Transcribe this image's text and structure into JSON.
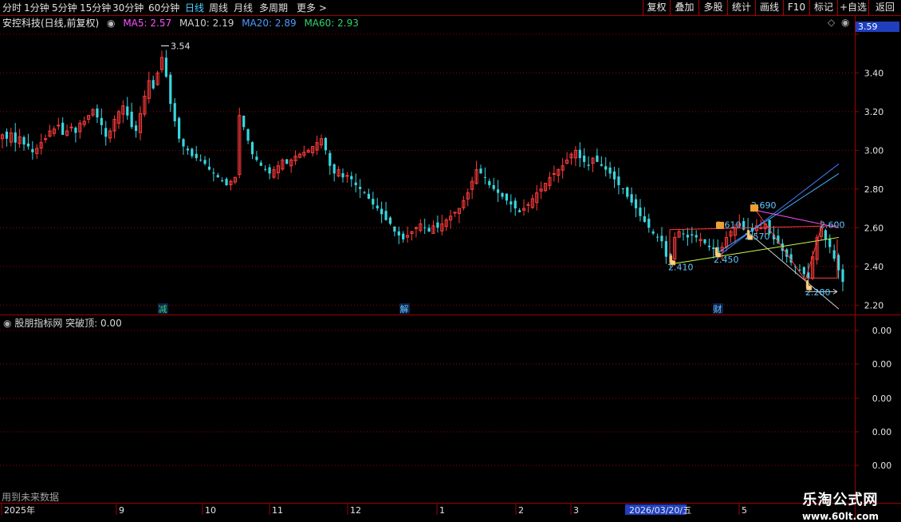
{
  "toolbar": {
    "periods": [
      {
        "label": "分时",
        "x": 0
      },
      {
        "label": "1分钟"
      },
      {
        "label": "5分钟"
      },
      {
        "label": "15分钟"
      },
      {
        "label": "30分钟"
      },
      {
        "label": "60分钟"
      },
      {
        "label": "日线",
        "active": true
      },
      {
        "label": "周线"
      },
      {
        "label": "月线"
      },
      {
        "label": "多周期"
      },
      {
        "label": "更多 >"
      }
    ],
    "right_buttons": [
      "复权",
      "叠加",
      "多股",
      "统计",
      "画线",
      "F10",
      "标记",
      "+自选",
      "返回"
    ]
  },
  "info": {
    "stock_title": "安控科技(日线,前复权)",
    "ma5": "MA5: 2.57",
    "ma10": "MA10: 2.19",
    "ma20": "MA20: 2.89",
    "ma60": "MA60: 2.93",
    "diamond_glyph": "◇"
  },
  "colors": {
    "up": "#ff3b3b",
    "down": "#39d6e0",
    "ma5": "#ff4fff",
    "ma10": "#d0d0d0",
    "ma20": "#4a9cff",
    "ma60": "#2fd46f",
    "grid": "#a00000",
    "axis_text": "#e6e6e6"
  },
  "chart_data": [
    {
      "type": "candlestick",
      "yrange": [
        2.16,
        3.62
      ],
      "yticks": [
        "3.40",
        "3.20",
        "3.00",
        "2.80",
        "2.60",
        "2.40",
        "2.20"
      ],
      "current_price": "3.59",
      "high_label": "3.54",
      "price_labels": [
        "2.410",
        "2.450",
        "2.610",
        "2.690",
        "2.570",
        "2.600",
        "2.280"
      ],
      "event_markers": [
        "减",
        "解",
        "财"
      ],
      "series": [
        {
          "name": "close",
          "values": [
            3.08,
            3.06,
            3.09,
            3.04,
            3.07,
            3.03,
            3.02,
            2.99,
            3.01,
            3.04,
            3.06,
            3.1,
            3.11,
            3.13,
            3.08,
            3.1,
            3.12,
            3.09,
            3.14,
            3.15,
            3.18,
            3.21,
            3.17,
            3.13,
            3.07,
            3.1,
            3.16,
            3.2,
            3.23,
            3.18,
            3.12,
            3.1,
            3.19,
            3.28,
            3.36,
            3.32,
            3.4,
            3.48,
            3.38,
            3.24,
            3.15,
            3.06,
            3.02,
            3.0,
            2.97,
            2.96,
            2.95,
            2.93,
            2.9,
            2.88,
            2.86,
            2.84,
            2.82,
            2.84,
            2.86,
            3.18,
            3.12,
            3.05,
            2.98,
            2.95,
            2.92,
            2.9,
            2.88,
            2.9,
            2.92,
            2.95,
            2.93,
            2.95,
            2.97,
            2.98,
            2.99,
            3.0,
            3.02,
            3.04,
            3.06,
            3.0,
            2.92,
            2.88,
            2.9,
            2.86,
            2.87,
            2.85,
            2.82,
            2.8,
            2.78,
            2.75,
            2.72,
            2.7,
            2.67,
            2.64,
            2.62,
            2.58,
            2.56,
            2.54,
            2.56,
            2.58,
            2.6,
            2.62,
            2.6,
            2.58,
            2.61,
            2.6,
            2.62,
            2.64,
            2.66,
            2.68,
            2.7,
            2.74,
            2.78,
            2.84,
            2.9,
            2.88,
            2.86,
            2.82,
            2.8,
            2.78,
            2.76,
            2.74,
            2.72,
            2.7,
            2.68,
            2.7,
            2.72,
            2.75,
            2.78,
            2.8,
            2.83,
            2.86,
            2.88,
            2.9,
            2.92,
            2.95,
            2.98,
            3.0,
            2.96,
            2.94,
            2.92,
            2.96,
            2.94,
            2.92,
            2.9,
            2.88,
            2.85,
            2.82,
            2.8,
            2.76,
            2.73,
            2.7,
            2.66,
            2.63,
            2.6,
            2.57,
            2.55,
            2.53,
            2.45,
            2.42,
            2.55,
            2.58,
            2.57,
            2.55,
            2.56,
            2.55,
            2.54,
            2.52,
            2.5,
            2.49,
            2.47,
            2.5,
            2.55,
            2.58,
            2.6,
            2.62,
            2.59,
            2.6,
            2.58,
            2.61,
            2.6,
            2.62,
            2.57,
            2.54,
            2.52,
            2.48,
            2.45,
            2.42,
            2.4,
            2.38,
            2.36,
            2.34,
            2.45,
            2.55,
            2.6,
            2.54,
            2.5,
            2.44,
            2.38,
            2.32
          ]
        }
      ]
    },
    {
      "type": "line",
      "title": "股朋指标网 突破顶: 0.00",
      "yticks": [
        "0.00",
        "0.00",
        "0.00",
        "0.00",
        "0.00"
      ],
      "series": [
        {
          "name": "突破顶",
          "values": []
        }
      ]
    }
  ],
  "xaxis": {
    "labels": [
      "2025年",
      "9",
      "10",
      "11",
      "12",
      "1",
      "2",
      "3",
      "2026/03/20/五",
      "5"
    ]
  },
  "notes": {
    "future_data": "用到未来数据"
  },
  "watermark": {
    "line1": "乐淘公式网",
    "line2": "www.60lt.com"
  }
}
